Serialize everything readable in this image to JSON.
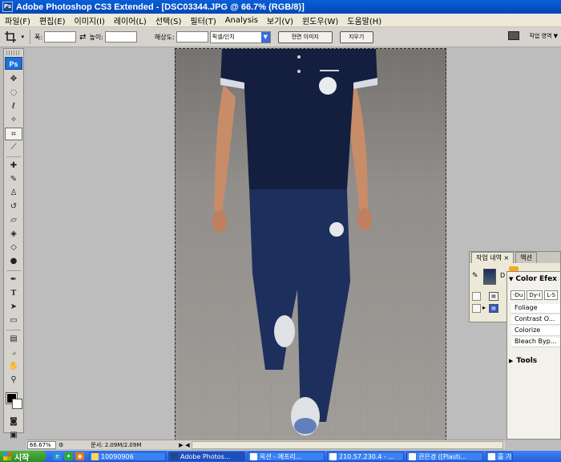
{
  "window": {
    "title": "Adobe Photoshop CS3 Extended - [DSC03344.JPG @ 66.7% (RGB/8)]",
    "app_badge": "Ps"
  },
  "menu": [
    "파일(F)",
    "편집(E)",
    "이미지(I)",
    "레이어(L)",
    "선택(S)",
    "필터(T)",
    "Analysis",
    "보기(V)",
    "윈도우(W)",
    "도움말(H)"
  ],
  "options": {
    "width_label": "폭:",
    "height_label": "높이:",
    "resolution_label": "해상도:",
    "unit_value": "픽셀/인치",
    "front_image_button": "전면 이미지",
    "clear_button": "지우기",
    "workspace_label": "작업 영역 ▼"
  },
  "toolbox": {
    "logo": "Ps"
  },
  "status": {
    "zoom": "66.67%",
    "doc_info": "문서: 2.09M/2.09M"
  },
  "history_panel": {
    "tab_history": "작업 내역",
    "tab_actions": "액션",
    "snapshot_label": "D"
  },
  "efex_panel": {
    "title": "Color Efex P",
    "chips": [
      "-Du",
      "Dy-I",
      "L-S"
    ],
    "filters": [
      "Foliage",
      "Contrast O...",
      "Colorize",
      "Bleach Byp..."
    ],
    "tools_label": "Tools"
  },
  "taskbar": {
    "start_label": "시작",
    "tasks": [
      "10090906",
      "Adobe Photos...",
      "옥션 - 에프리...",
      "210.57.230.4 - ...",
      "권은경 ([Plasti...",
      "흘 가..."
    ]
  }
}
